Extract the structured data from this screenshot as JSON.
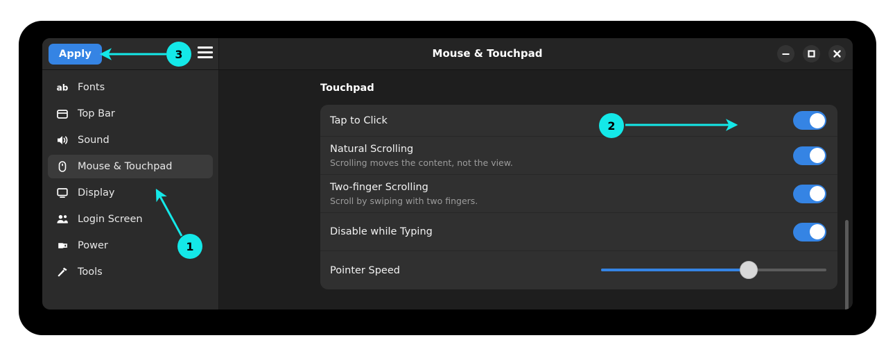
{
  "window": {
    "title": "Mouse & Touchpad",
    "controls": [
      {
        "name": "minimize",
        "glyph": "minimize-icon"
      },
      {
        "name": "maximize",
        "glyph": "maximize-icon"
      },
      {
        "name": "close",
        "glyph": "close-icon"
      }
    ]
  },
  "header": {
    "apply_label": "Apply",
    "menu_icon": "hamburger-menu-icon"
  },
  "sidebar": {
    "items": [
      {
        "label": "Fonts",
        "icon": "fonts-icon",
        "selected": false
      },
      {
        "label": "Top Bar",
        "icon": "top-bar-icon",
        "selected": false
      },
      {
        "label": "Sound",
        "icon": "sound-icon",
        "selected": false
      },
      {
        "label": "Mouse & Touchpad",
        "icon": "mouse-icon",
        "selected": true
      },
      {
        "label": "Display",
        "icon": "display-icon",
        "selected": false
      },
      {
        "label": "Login Screen",
        "icon": "login-screen-icon",
        "selected": false
      },
      {
        "label": "Power",
        "icon": "power-plug-icon",
        "selected": false
      },
      {
        "label": "Tools",
        "icon": "tools-icon",
        "selected": false
      }
    ]
  },
  "content": {
    "section_title": "Touchpad",
    "rows": [
      {
        "title": "Tap to Click",
        "subtitle": "",
        "control": "toggle",
        "value": "on"
      },
      {
        "title": "Natural Scrolling",
        "subtitle": "Scrolling moves the content, not the view.",
        "control": "toggle",
        "value": "on"
      },
      {
        "title": "Two-finger Scrolling",
        "subtitle": "Scroll by swiping with two fingers.",
        "control": "toggle",
        "value": "on"
      },
      {
        "title": "Disable while Typing",
        "subtitle": "",
        "control": "toggle",
        "value": "on"
      },
      {
        "title": "Pointer Speed",
        "subtitle": "",
        "control": "slider",
        "value": "67"
      }
    ]
  },
  "annotations": {
    "markers": [
      {
        "label": "1",
        "target": "sidebar-item-mouse-touchpad"
      },
      {
        "label": "2",
        "target": "tap-to-click-toggle"
      },
      {
        "label": "3",
        "target": "apply-button"
      }
    ]
  },
  "colors": {
    "accent": "#3584e4",
    "annotation": "#14e8e8",
    "window_bg": "#1e1e1e",
    "sidebar_bg": "#2b2b2b",
    "card_bg": "#303030"
  }
}
